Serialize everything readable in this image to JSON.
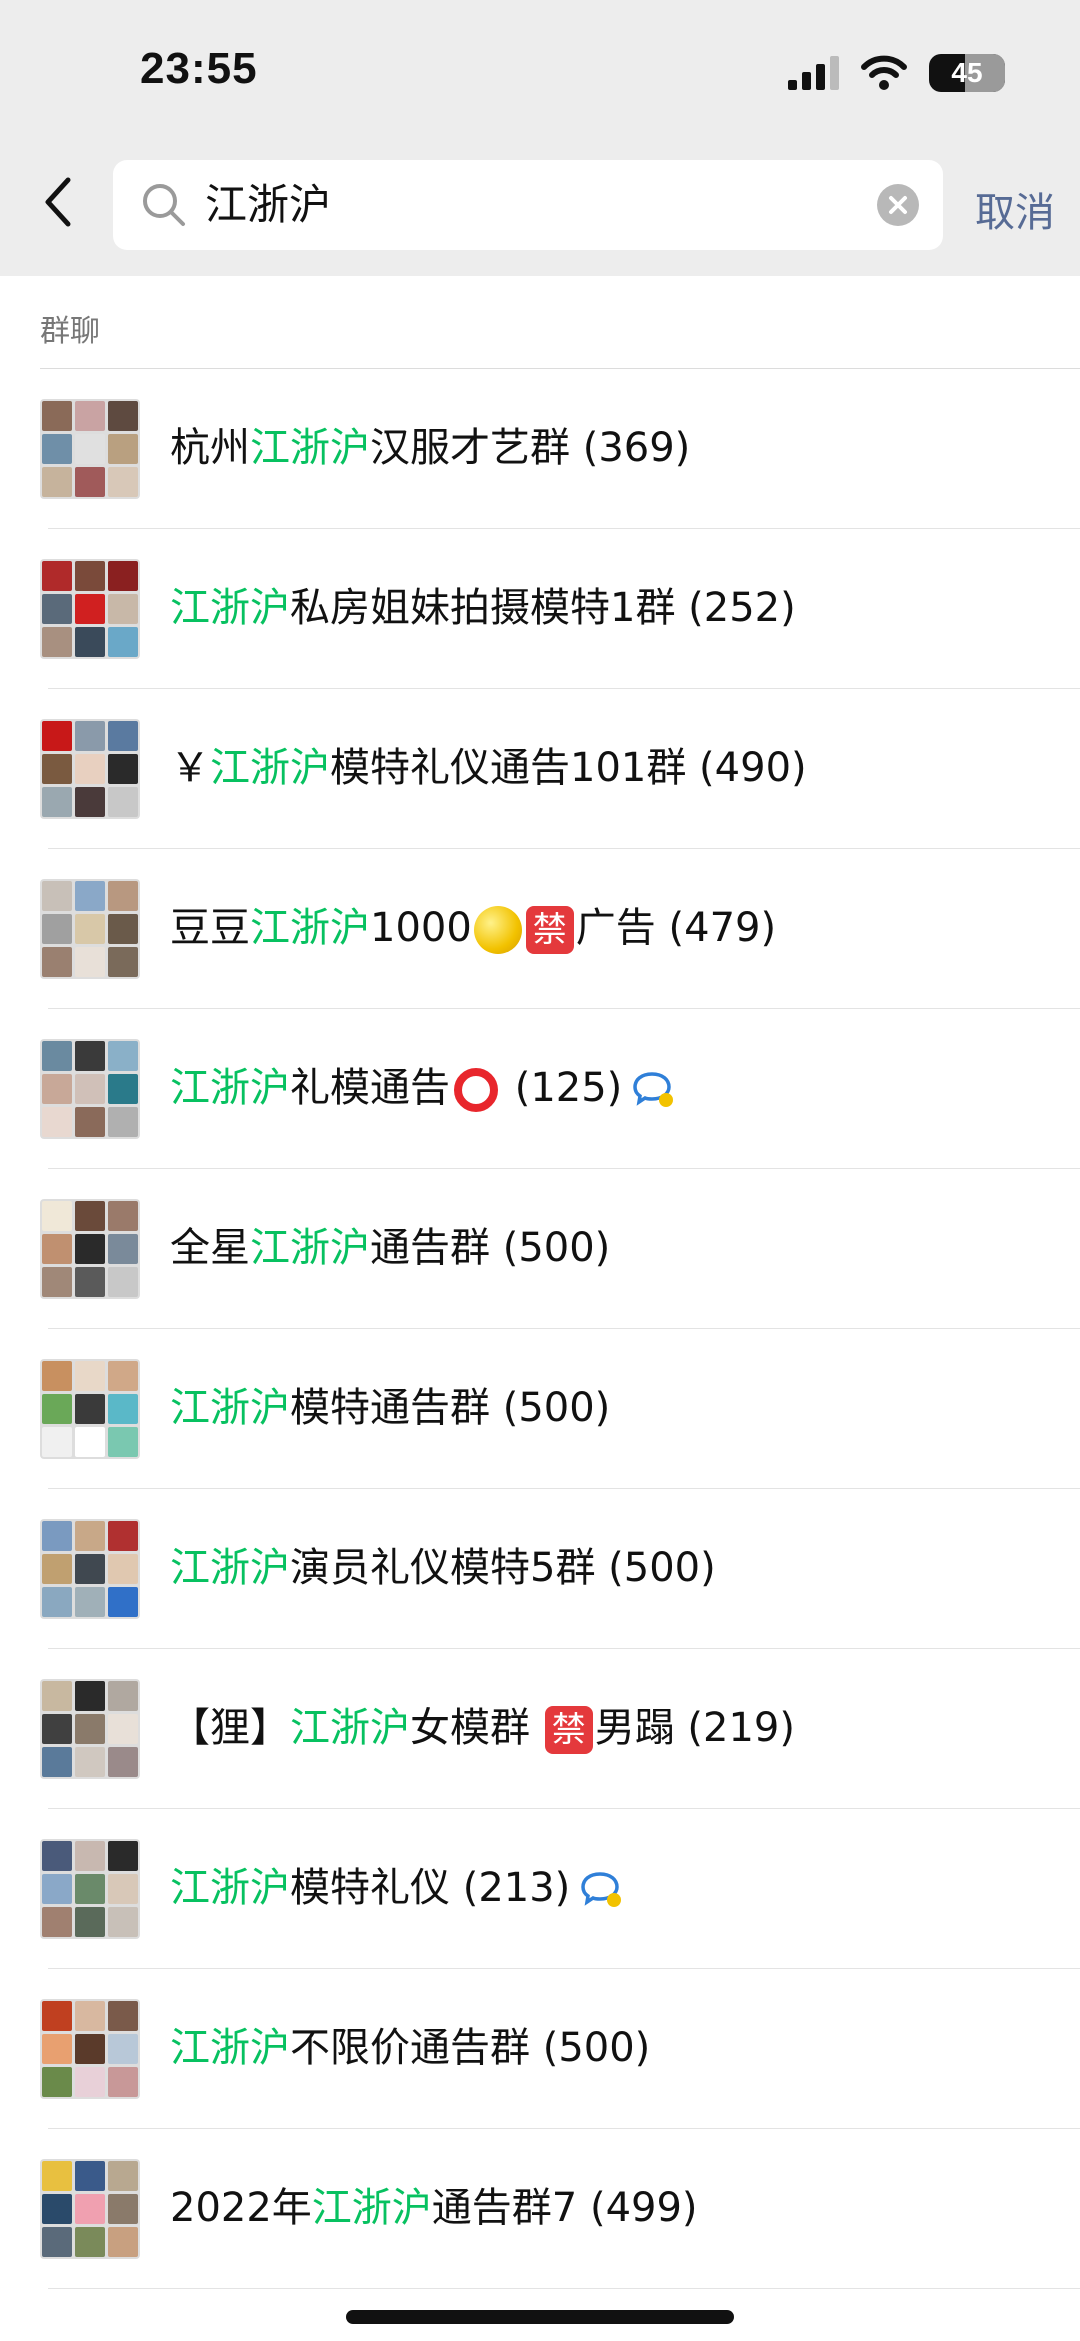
{
  "status_bar": {
    "time": "23:55",
    "battery": "45"
  },
  "search": {
    "query": "江浙沪",
    "cancel_label": "取消"
  },
  "section": {
    "title": "群聊"
  },
  "colors": {
    "highlight": "#07c160",
    "link": "#576b95"
  },
  "groups": [
    {
      "pre": "杭州",
      "hl": "江浙沪",
      "post": "汉服才艺群 (369)",
      "icon": "",
      "avatar": [
        "#8a6a58",
        "#c9a3a3",
        "#5e4a40",
        "#6f8fa8",
        "#e0e0e0",
        "#b9a080",
        "#c6b39c",
        "#a05a5a",
        "#d8c8b8"
      ]
    },
    {
      "pre": "",
      "hl": "江浙沪",
      "post": "私房姐妹拍摄模特1群 (252)",
      "icon": "",
      "avatar": [
        "#b02a2a",
        "#7a4a3a",
        "#8a2020",
        "#5a6a7a",
        "#d02020",
        "#c8b8a8",
        "#a89080",
        "#3a4a5a",
        "#6aa8c8"
      ]
    },
    {
      "pre": "￥",
      "hl": "江浙沪",
      "post": "模特礼仪通告101群 (490)",
      "icon": "",
      "avatar": [
        "#c81818",
        "#8a9aaa",
        "#5a7aa0",
        "#7a5a40",
        "#e8d0c0",
        "#2a2a2a",
        "#9aa8b0",
        "#4a3a3a",
        "#c8c8c8"
      ]
    },
    {
      "pre": "豆豆",
      "hl": "江浙沪",
      "post": "1000",
      "icon": "coin-ban",
      "post2": "广告 (479)",
      "avatar": [
        "#c8c0b8",
        "#8aa8c8",
        "#b89880",
        "#a0a0a0",
        "#d8c8a8",
        "#6a5a4a",
        "#9a8070",
        "#e8e0d8",
        "#7a6a5a"
      ]
    },
    {
      "pre": "",
      "hl": "江浙沪",
      "post": "礼模通告",
      "icon": "ring-chat",
      "post2": "(125)",
      "avatar": [
        "#6a8aa0",
        "#3a3a3a",
        "#8ab0c8",
        "#c8a898",
        "#d0c0b8",
        "#2a7a8a",
        "#e8d8d0",
        "#8a6a5a",
        "#b0b0b0"
      ]
    },
    {
      "pre": "全星",
      "hl": "江浙沪",
      "post": "通告群 (500)",
      "icon": "",
      "avatar": [
        "#f0e8d8",
        "#6a4a3a",
        "#9a7a6a",
        "#c09070",
        "#2a2a2a",
        "#7a8a9a",
        "#a08878",
        "#5a5a5a",
        "#c8c8c8"
      ]
    },
    {
      "pre": "",
      "hl": "江浙沪",
      "post": "模特通告群 (500)",
      "icon": "",
      "avatar": [
        "#c89060",
        "#e8d8c8",
        "#d0a888",
        "#6aa858",
        "#3a3a3a",
        "#5ab8c8",
        "#f0f0f0",
        "#ffffff",
        "#7ac8b0"
      ]
    },
    {
      "pre": "",
      "hl": "江浙沪",
      "post": "演员礼仪模特5群 (500)",
      "icon": "",
      "avatar": [
        "#7a9ac0",
        "#c8a888",
        "#b03030",
        "#c0a070",
        "#404850",
        "#e0c8b0",
        "#8aa8c0",
        "#a0b0b8",
        "#3070c8"
      ]
    },
    {
      "pre": "【狸】",
      "hl": "江浙沪",
      "post": "女模群 ",
      "icon": "ban",
      "post2": "男蹋 (219)",
      "avatar": [
        "#c8b8a0",
        "#2a2a2a",
        "#b0a8a0",
        "#404040",
        "#8a7a6a",
        "#e8e0d8",
        "#5a7a9a",
        "#d0c8c0",
        "#9a8a8a"
      ]
    },
    {
      "pre": "",
      "hl": "江浙沪",
      "post": "模特礼仪 (213)",
      "icon": "chat",
      "avatar": [
        "#4a5a7a",
        "#c8b8b0",
        "#2a2a2a",
        "#8aa8c8",
        "#6a8a6a",
        "#d8c8b8",
        "#a08070",
        "#5a6a5a",
        "#c8c0b8"
      ]
    },
    {
      "pre": "",
      "hl": "江浙沪",
      "post": "不限价通告群 (500)",
      "icon": "",
      "avatar": [
        "#c04020",
        "#d8b8a0",
        "#7a5a4a",
        "#e8a070",
        "#5a3a2a",
        "#b8c8d8",
        "#6a8a4a",
        "#e8d0d8",
        "#c89898"
      ]
    },
    {
      "pre": "2022年",
      "hl": "江浙沪",
      "post": "通告群7 (499)",
      "icon": "",
      "avatar": [
        "#e8c040",
        "#3a5a8a",
        "#b8a890",
        "#2a4a6a",
        "#f0a0b0",
        "#8a7a6a",
        "#5a6a7a",
        "#7a8a5a",
        "#c8a080"
      ]
    }
  ]
}
